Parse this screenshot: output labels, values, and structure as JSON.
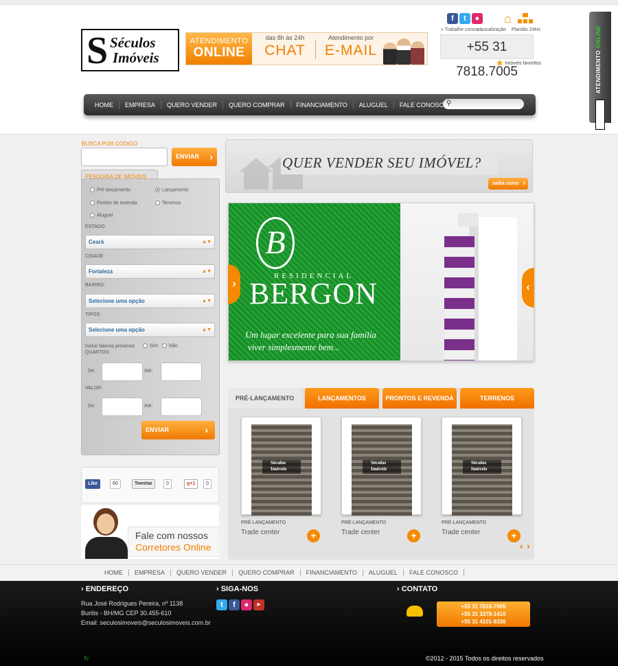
{
  "header": {
    "logo_line1": "Séculos",
    "logo_line2": "Imóveis",
    "logo_letter": "S",
    "banner": {
      "online_top": "ATENDIMENTO",
      "online_main": "ONLINE",
      "chat_caption": "das 8h às 24h",
      "chat_label": "CHAT",
      "email_caption": "Atendimento por",
      "email_label": "E-MAIL"
    },
    "social_icons": [
      "facebook-icon",
      "twitter-icon",
      "flickr-icon"
    ],
    "top_links": {
      "work": "» Trabalhe conosco",
      "location": "» Localização",
      "on_call": "Plantão 24Hs"
    },
    "phone": "+55 31 7818.7005",
    "favorites": "Imóveis favoritos",
    "side_tab": {
      "line1": "ATENDIMENTO",
      "line2": "ONLINE"
    }
  },
  "nav": {
    "items": [
      "HOME",
      "EMPRESA",
      "QUERO VENDER",
      "QUERO COMPRAR",
      "FINANCIAMENTO",
      "ALUGUEL",
      "FALE CONOSCO"
    ],
    "search_placeholder": ""
  },
  "sidebar": {
    "code_label": "BUSCA POR CODIGO",
    "send_label": "ENVIAR",
    "search_tab": "PESQUISA DE IMÓVEIS",
    "radios": [
      "Pré lançamento",
      "Lançamento",
      "Pontos de revenda",
      "Terrenos",
      "Aluguel"
    ],
    "estado_label": "ESTADO:",
    "estado_value": "Ceará",
    "cidade_label": "CIDADE:",
    "cidade_value": "Fortaleza",
    "bairro_label": "BAIRRO:",
    "bairro_value": "Selecione uma opção",
    "tipos_label": "TIPOS:",
    "tipos_value": "Selecione uma opção",
    "nearby_label": "Incluir bairros próximos",
    "yes": "Sim",
    "no": "Não",
    "quartos_label": "QUARTOS:",
    "valor_label": "VALOR:",
    "de": "De:",
    "ate": "Até:",
    "submit": "ENVIAR",
    "like": "Like",
    "like_count": "60",
    "tweet": "Tweetar",
    "tweet_count": "0",
    "gplus": "g+1",
    "gplus_count": "0",
    "corretores_1": "Fale com nossos",
    "corretores_2": "Corretores Online"
  },
  "main": {
    "sell_question": "QUER VENDER SEU IMÓVEL?",
    "sell_button": "saiba como",
    "slide": {
      "brand_small": "RESIDENCIAL",
      "brand": "BERGON",
      "tagline1": "Um lugar excelente para sua família",
      "tagline2": "viver simplesmente bem..."
    },
    "tabs": [
      "PRÉ-LANÇAMENTO",
      "LANÇAMENTOS",
      "PRONTOS E REVENDA",
      "TERRENOS"
    ],
    "cards": [
      {
        "category": "PRÉ-LANÇAMENTO",
        "name": "Trade center",
        "watermark1": "Séculos",
        "watermark2": "Imóveis"
      },
      {
        "category": "PRÉ-LANÇAMENTO",
        "name": "Trade center",
        "watermark1": "Séculos",
        "watermark2": "Imóveis"
      },
      {
        "category": "PRÉ-LANÇAMENTO",
        "name": "Trade center",
        "watermark1": "Séculos",
        "watermark2": "Imóveis"
      }
    ]
  },
  "footer_nav": [
    "HOME",
    "EMPRESA",
    "QUERO VENDER",
    "QUERO COMPRAR",
    "FINANCIAMENTO",
    "ALUGUEL",
    "FALE CONOSCO"
  ],
  "footer": {
    "address_title": "› ENDEREÇO",
    "address1": "Rua José Rodrigues Pereira, nº 1138",
    "address2": "Buritis - BH/MG CEP 30.455-610",
    "email": "Email: seculosimoveis@seculosimoveis.com.br",
    "follow_title": "› SIGA-NOS",
    "contact_title": "› CONTATO",
    "phones": [
      "+55 31 7818-7005",
      "+55 31 3378-1410",
      "+55 31 4101-8336"
    ],
    "copyright": "©2012 - 2015 Todos os direitos reservados"
  },
  "colors": {
    "accent": "#f08000",
    "nav": "#3a3a3a",
    "link": "#2a6aa0"
  }
}
